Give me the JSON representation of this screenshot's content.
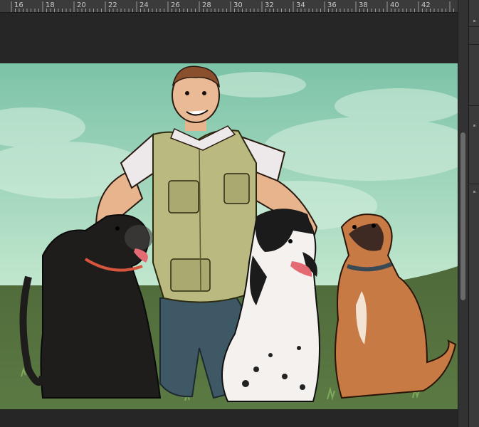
{
  "ruler": {
    "ticks": [
      "16",
      "18",
      "20",
      "22",
      "24",
      "26",
      "28",
      "30",
      "32",
      "34",
      "36",
      "38",
      "40",
      "42"
    ]
  },
  "artwork": {
    "subject": "illustration"
  }
}
